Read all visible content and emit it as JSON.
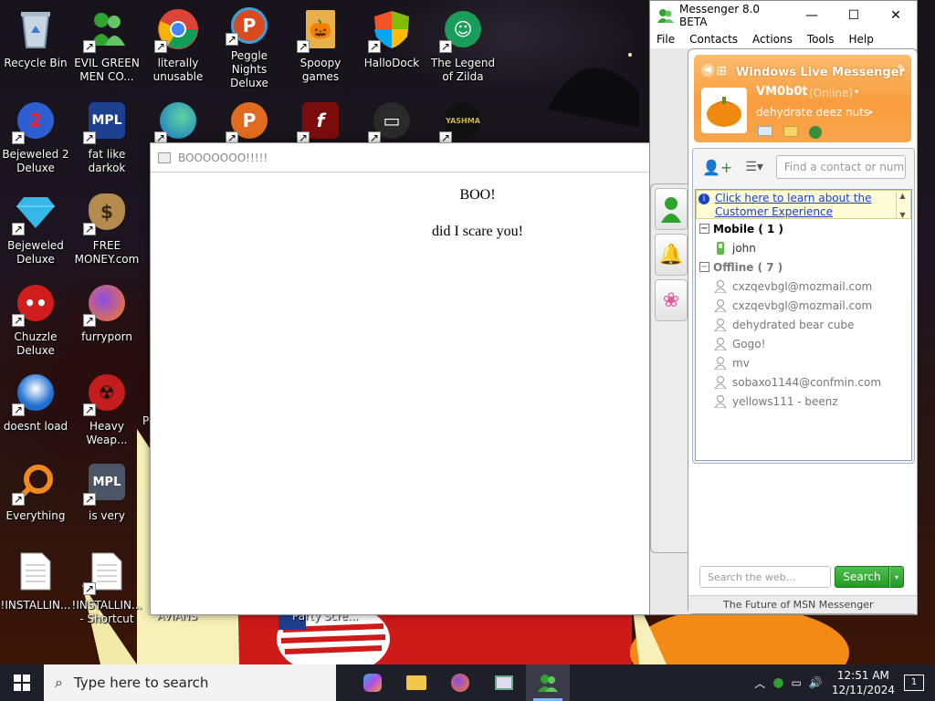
{
  "desktop": {
    "icons": [
      {
        "id": "recycle",
        "label": "Recycle Bin"
      },
      {
        "id": "evil",
        "label": "EVIL GREEN MEN CO..."
      },
      {
        "id": "chrome",
        "label": "literally unusable"
      },
      {
        "id": "peggle",
        "label": "Peggle Nights Deluxe"
      },
      {
        "id": "spoopy",
        "label": "Spoopy games"
      },
      {
        "id": "hallodock",
        "label": "HalloDock"
      },
      {
        "id": "zilda",
        "label": "The Legend of Zilda"
      },
      {
        "id": "bejeweled2",
        "label": "Bejeweled 2 Deluxe"
      },
      {
        "id": "fatlike",
        "label": "fat like darkok"
      },
      {
        "id": "bejeweled",
        "label": "Bejeweled Deluxe"
      },
      {
        "id": "freemoney",
        "label": "FREE MONEY.com"
      },
      {
        "id": "chuzzle",
        "label": "Chuzzle Deluxe"
      },
      {
        "id": "furry",
        "label": "furryporn"
      },
      {
        "id": "thunder",
        "label": "doesnt load"
      },
      {
        "id": "heavy",
        "label": "Heavy Weap..."
      },
      {
        "id": "everything",
        "label": "Everything"
      },
      {
        "id": "isvery",
        "label": "is very"
      },
      {
        "id": "install1",
        "label": "!INSTALLIN..."
      },
      {
        "id": "install2",
        "label": "!INSTALLIN... - Shortcut"
      }
    ],
    "partial_labels": [
      "P",
      "AVIANS",
      "Party Scre..."
    ]
  },
  "popup": {
    "title": "BOOOOOOO!!!!!",
    "line1": "BOO!",
    "line2": "did I scare you!"
  },
  "messenger": {
    "title": "Messenger 8.0 BETA",
    "menu": [
      "File",
      "Contacts",
      "Actions",
      "Tools",
      "Help"
    ],
    "brand": "Windows Live Messenger",
    "username": "VM0b0t",
    "status": "(Online)",
    "personal_message": "dehydrate deez nuts",
    "find_placeholder": "Find a contact or number",
    "notice": "Click here to learn about the Customer Experience",
    "groups": [
      {
        "name": "Mobile ( 1 )",
        "contacts": [
          "john"
        ]
      },
      {
        "name": "Offline ( 7 )",
        "contacts": [
          "cxzqevbgl@mozmail.com",
          "cxzqevbgl@mozmail.com",
          "dehydrated bear cube",
          "Gogo!",
          "mv",
          "sobaxo1144@confmin.com",
          "yellows111 - beenz"
        ]
      }
    ],
    "web_search_placeholder": "Search the web...",
    "search_label": "Search",
    "footer": "The Future of MSN Messenger"
  },
  "taskbar": {
    "search_placeholder": "Type here to search",
    "time": "12:51 AM",
    "date": "12/11/2024"
  },
  "colors": {
    "accent": "#f89d3f",
    "taskbar": "#1f1f2a",
    "link": "#1a44c4",
    "search_green": "#229a22"
  }
}
